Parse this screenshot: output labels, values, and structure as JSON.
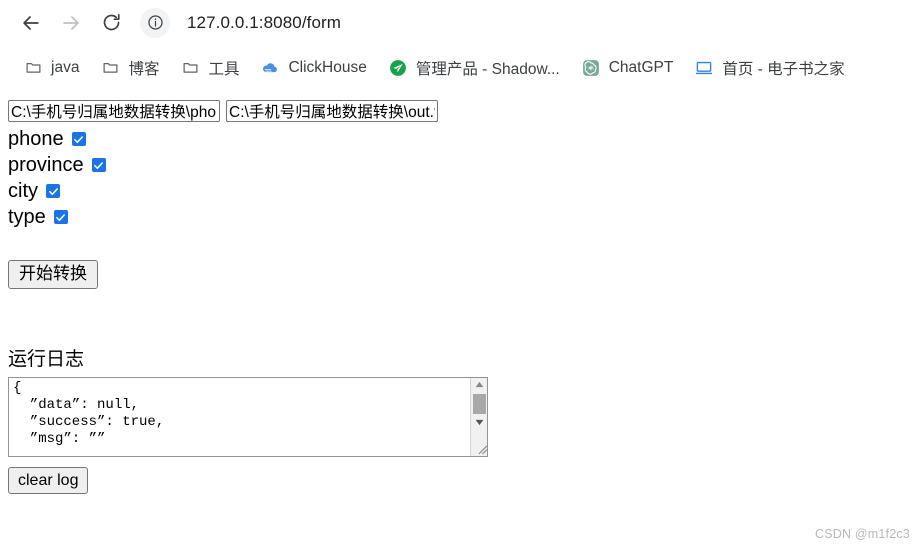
{
  "browser": {
    "back_icon": "back-arrow-icon",
    "forward_icon": "forward-arrow-icon",
    "reload_icon": "reload-icon",
    "site_info_icon": "info-circle-icon",
    "url": "127.0.0.1:8080/form",
    "bookmarks": [
      {
        "label": "java",
        "icon": "folder-icon"
      },
      {
        "label": "博客",
        "icon": "folder-icon"
      },
      {
        "label": "工具",
        "icon": "folder-icon"
      },
      {
        "label": "ClickHouse",
        "icon": "cloud-icon"
      },
      {
        "label": "管理产品 - Shadow...",
        "icon": "paper-plane-icon"
      },
      {
        "label": "ChatGPT",
        "icon": "chatgpt-spiral-icon"
      },
      {
        "label": "首页 - 电子书之家",
        "icon": "monitor-icon"
      }
    ]
  },
  "form": {
    "input_path_1": "C:\\手机号归属地数据转换\\phone.txt",
    "input_path_2": "C:\\手机号归属地数据转换\\out.txt",
    "checkboxes": [
      {
        "label": "phone",
        "checked": true
      },
      {
        "label": "province",
        "checked": true
      },
      {
        "label": "city",
        "checked": true
      },
      {
        "label": "type",
        "checked": true
      }
    ],
    "start_button": "开始转换"
  },
  "log": {
    "title": "运行日志",
    "content": "{\n  ”data”: null,\n  ”success”: true,\n  ”msg”: ””",
    "clear_button": "clear log",
    "scroll_up_icon": "triangle-up-icon",
    "scroll_down_icon": "triangle-down-icon",
    "resize_grip_icon": "resize-grip-icon"
  },
  "watermark": "CSDN @m1f2c3",
  "colors": {
    "accent_blue": "#1a73e8",
    "bookmark_text": "#3c4043",
    "url_text": "#202124",
    "watermark": "#b8b8b8"
  }
}
